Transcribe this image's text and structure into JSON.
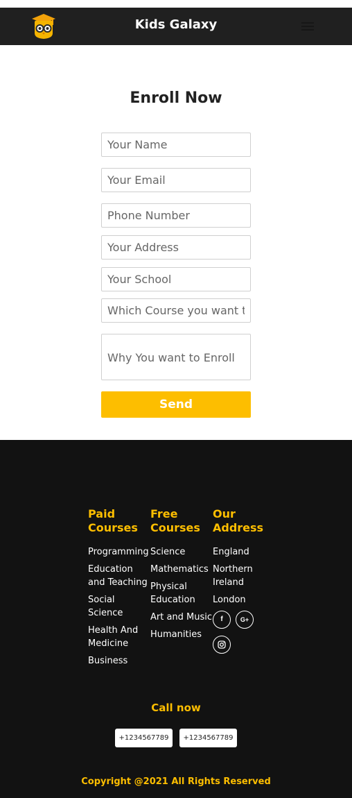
{
  "header": {
    "brand": "Kids Galaxy",
    "logo_icon": "owl-graduation-cap-icon",
    "menu_icon": "hamburger-menu-icon"
  },
  "form": {
    "title": "Enroll Now",
    "fields": {
      "name": "Your Name",
      "email": "Your Email",
      "phone": "Phone Number",
      "address": "Your Address",
      "school": "Your School",
      "course": "Which Course you want to",
      "reason": "Why You want to Enroll"
    },
    "send_label": "Send",
    "accent": "#fdbe00"
  },
  "footer": {
    "paid_heading": "Paid Courses",
    "paid_items": [
      "Programming",
      "Education and Teaching",
      "Social Science",
      "Health And Medicine",
      "Business"
    ],
    "free_heading": "Free Courses",
    "free_items": [
      "Science",
      "Mathematics",
      "Physical Education",
      "Art and Music",
      "Humanities"
    ],
    "address_heading": "Our Address",
    "address_items": [
      "England",
      "Northern Ireland",
      "London"
    ],
    "socials": {
      "facebook": "f",
      "googleplus": "G+",
      "instagram": "instagram-icon"
    },
    "call_label": "Call now",
    "phones": [
      "+1234567789",
      "+1234567789"
    ],
    "copyright": "Copyright @2021 All Rights Reserved"
  }
}
